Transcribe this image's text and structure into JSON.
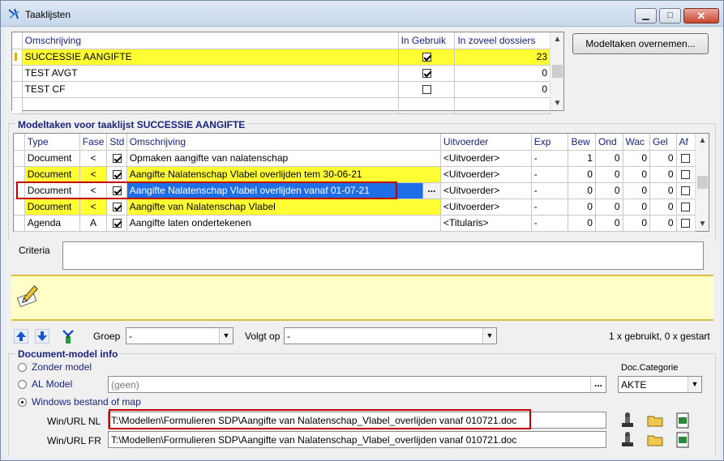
{
  "window": {
    "title": "Taaklijsten",
    "minimize": "▁",
    "maximize": "□",
    "close": "✕"
  },
  "tasklists": {
    "columns": [
      "Omschrijving",
      "In Gebruik",
      "In zoveel dossiers"
    ],
    "rows": [
      {
        "name": "SUCCESSIE AANGIFTE",
        "in_use": true,
        "count": "23",
        "highlight": true
      },
      {
        "name": "TEST AVGT",
        "in_use": true,
        "count": "0",
        "highlight": false
      },
      {
        "name": "TEST CF",
        "in_use": false,
        "count": "0",
        "highlight": false
      }
    ]
  },
  "buttons": {
    "take_over": "Modeltaken overnemen..."
  },
  "modeltasks": {
    "title": "Modeltaken voor taaklijst SUCCESSIE AANGIFTE",
    "columns": [
      "Type",
      "Fase",
      "Std",
      "Omschrijving",
      "Uitvoerder",
      "Exp",
      "Bew",
      "Ond",
      "Wac",
      "Gel",
      "Af"
    ],
    "rows": [
      {
        "type": "Document",
        "fase": "<",
        "std": true,
        "desc": "Opmaken aangifte van nalatenschap",
        "exec": "<Uitvoerder>",
        "exp": "-",
        "bew": "1",
        "ond": "0",
        "wac": "0",
        "gel": "0",
        "af": false,
        "highlight": false
      },
      {
        "type": "Document",
        "fase": "<",
        "std": true,
        "desc": "Aangifte Nalatenschap Vlabel overlijden tem 30-06-21",
        "exec": "<Uitvoerder>",
        "exp": "-",
        "bew": "0",
        "ond": "0",
        "wac": "0",
        "gel": "0",
        "af": false,
        "highlight": true
      },
      {
        "type": "Document",
        "fase": "<",
        "std": true,
        "desc": "Aangifte Nalatenschap Vlabel overlijden vanaf 01-07-21",
        "exec": "<Uitvoerder>",
        "exp": "-",
        "bew": "0",
        "ond": "0",
        "wac": "0",
        "gel": "0",
        "af": false,
        "highlight": false,
        "selected": true
      },
      {
        "type": "Document",
        "fase": "<",
        "std": true,
        "desc": "Aangifte van Nalatenschap Vlabel",
        "exec": "<Uitvoerder>",
        "exp": "-",
        "bew": "0",
        "ond": "0",
        "wac": "0",
        "gel": "0",
        "af": false,
        "highlight": true
      },
      {
        "type": "Agenda",
        "fase": "A",
        "std": true,
        "desc": "Aangifte laten ondertekenen",
        "exec": "<Titularis>",
        "exp": "-",
        "bew": "0",
        "ond": "0",
        "wac": "0",
        "gel": "0",
        "af": false,
        "highlight": false
      }
    ],
    "ellipsis": "..."
  },
  "criteria": {
    "label": "Criteria",
    "value": ""
  },
  "toolbar": {
    "groep_label": "Groep",
    "groep_value": "-",
    "volgt_label": "Volgt op",
    "volgt_value": "-",
    "usage": "1 x gebruikt, 0 x gestart"
  },
  "docmodel": {
    "title": "Document-model info",
    "opt_none": "Zonder model",
    "opt_al": "AL Model",
    "al_placeholder": "(geen)",
    "opt_windows": "Windows bestand of map",
    "cat_label": "Doc.Categorie",
    "cat_value": "AKTE",
    "nl_label": "Win/URL NL",
    "nl_value": "T:\\Modellen\\Formulieren SDP\\Aangifte van Nalatenschap_Vlabel_overlijden vanaf 010721.doc",
    "fr_label": "Win/URL FR",
    "fr_value": "T:\\Modellen\\Formulieren SDP\\Aangifte van Nalatenschap_Vlabel_overlijden vanaf 010721.doc",
    "ellipsis": "..."
  },
  "colors": {
    "highlight": "#ffff33",
    "selection": "#1e6ee8",
    "accent": "#1a237e",
    "note": "#ffffc8"
  }
}
